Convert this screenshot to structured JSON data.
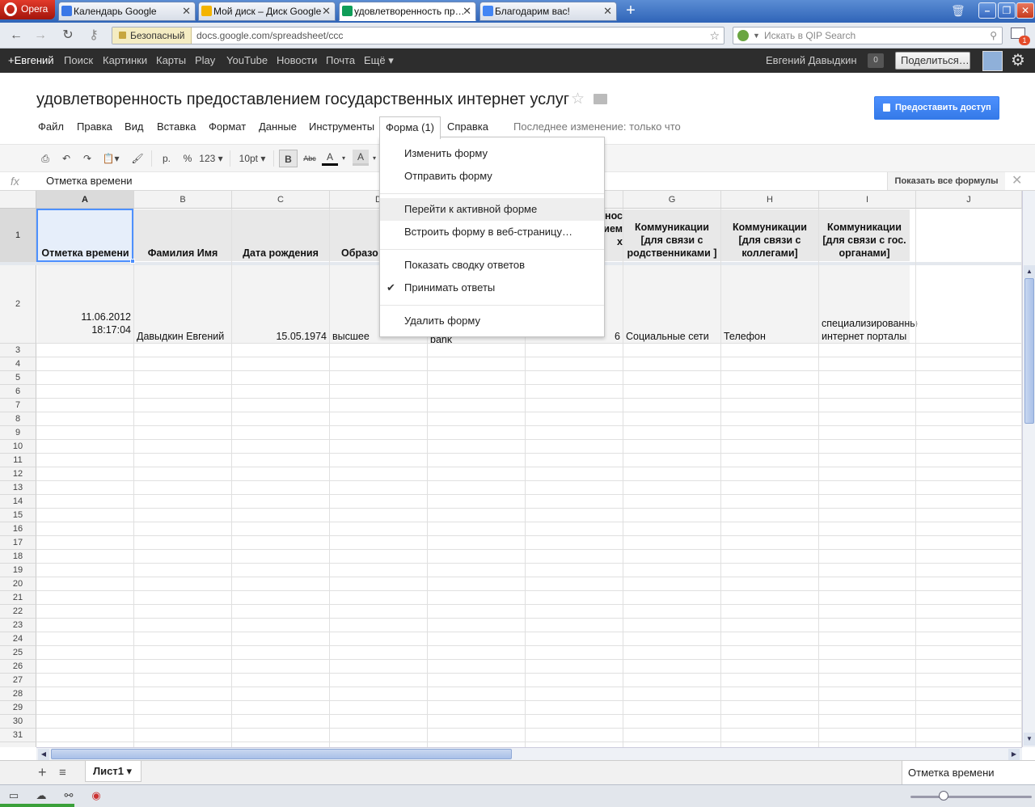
{
  "browser": {
    "opera_label": "Opera",
    "tabs": [
      {
        "label": "Календарь Google",
        "color": "#3b78e7"
      },
      {
        "label": "Мой диск – Диск Google",
        "color": "#f4b400"
      },
      {
        "label": "удовлетворенность пр…",
        "color": "#0f9d58"
      },
      {
        "label": "Благодарим вас!",
        "color": "#4285f4"
      }
    ],
    "new_tab": "+",
    "security_label": "Безопасный",
    "url": "docs.google.com/spreadsheet/ccc",
    "search_placeholder": "Искать в QIP Search",
    "mail_count": "1"
  },
  "gbar": {
    "links": [
      "+Евгений",
      "Поиск",
      "Картинки",
      "Карты",
      "Play",
      "YouTube",
      "Новости",
      "Почта",
      "Ещё ▾"
    ],
    "user_name": "Евгений Давыдкин",
    "notif_count": "0",
    "share_label": "Поделиться…"
  },
  "doc": {
    "title": "удовлетворенность предоставлением государственных интернет услуг",
    "share_button": "Предоставить доступ",
    "last_edit": "Последнее изменение: только что"
  },
  "menu": {
    "items": [
      "Файл",
      "Правка",
      "Вид",
      "Вставка",
      "Формат",
      "Данные",
      "Инструменты",
      "Форма (1)",
      "Справка"
    ]
  },
  "toolbar": {
    "currency": "р.",
    "percent": "%",
    "number_format": "123 ▾",
    "font_size": "10pt ▾",
    "bold": "B",
    "strike": "Abc",
    "text_color": "A",
    "fill_color": "A"
  },
  "formula_bar": {
    "fx": "fx",
    "value": "Отметка времени",
    "show_all": "Показать все формулы"
  },
  "dropdown": {
    "groups": [
      [
        "Изменить форму",
        "Отправить форму"
      ],
      [
        "Перейти к активной форме",
        "Встроить форму в веб-страницу…"
      ],
      [
        "Показать сводку ответов",
        "Принимать ответы"
      ],
      [
        "Удалить форму"
      ]
    ],
    "checked_item": "Принимать ответы",
    "hovered_item": "Перейти к активной форме"
  },
  "sheet": {
    "columns": [
      "A",
      "B",
      "C",
      "D",
      "E",
      "F",
      "G",
      "H",
      "I",
      "J"
    ],
    "header_row": [
      "Отметка времени",
      "Фамилия Имя",
      "Дата рождения",
      "Образо",
      "",
      "нос\nием\nх",
      "Коммуникации [для связи с родственниками ]",
      "Коммуникации [для связи с коллегами]",
      "Коммуникации [для связи с гос. органами]",
      ""
    ],
    "data_row": [
      "11.06.2012\n18:17:04",
      "Давыдкин Евгений",
      "15.05.1974",
      "высшее",
      "",
      "6",
      "Социальные сети",
      "Телефон",
      "специализированные\nинтернет порталы",
      ""
    ],
    "hidden_e2": "bank",
    "row_numbers_start": 3,
    "row_numbers_end": 31,
    "sheet_tab": "Лист1 ▾",
    "selected_info": "Отметка времени"
  }
}
